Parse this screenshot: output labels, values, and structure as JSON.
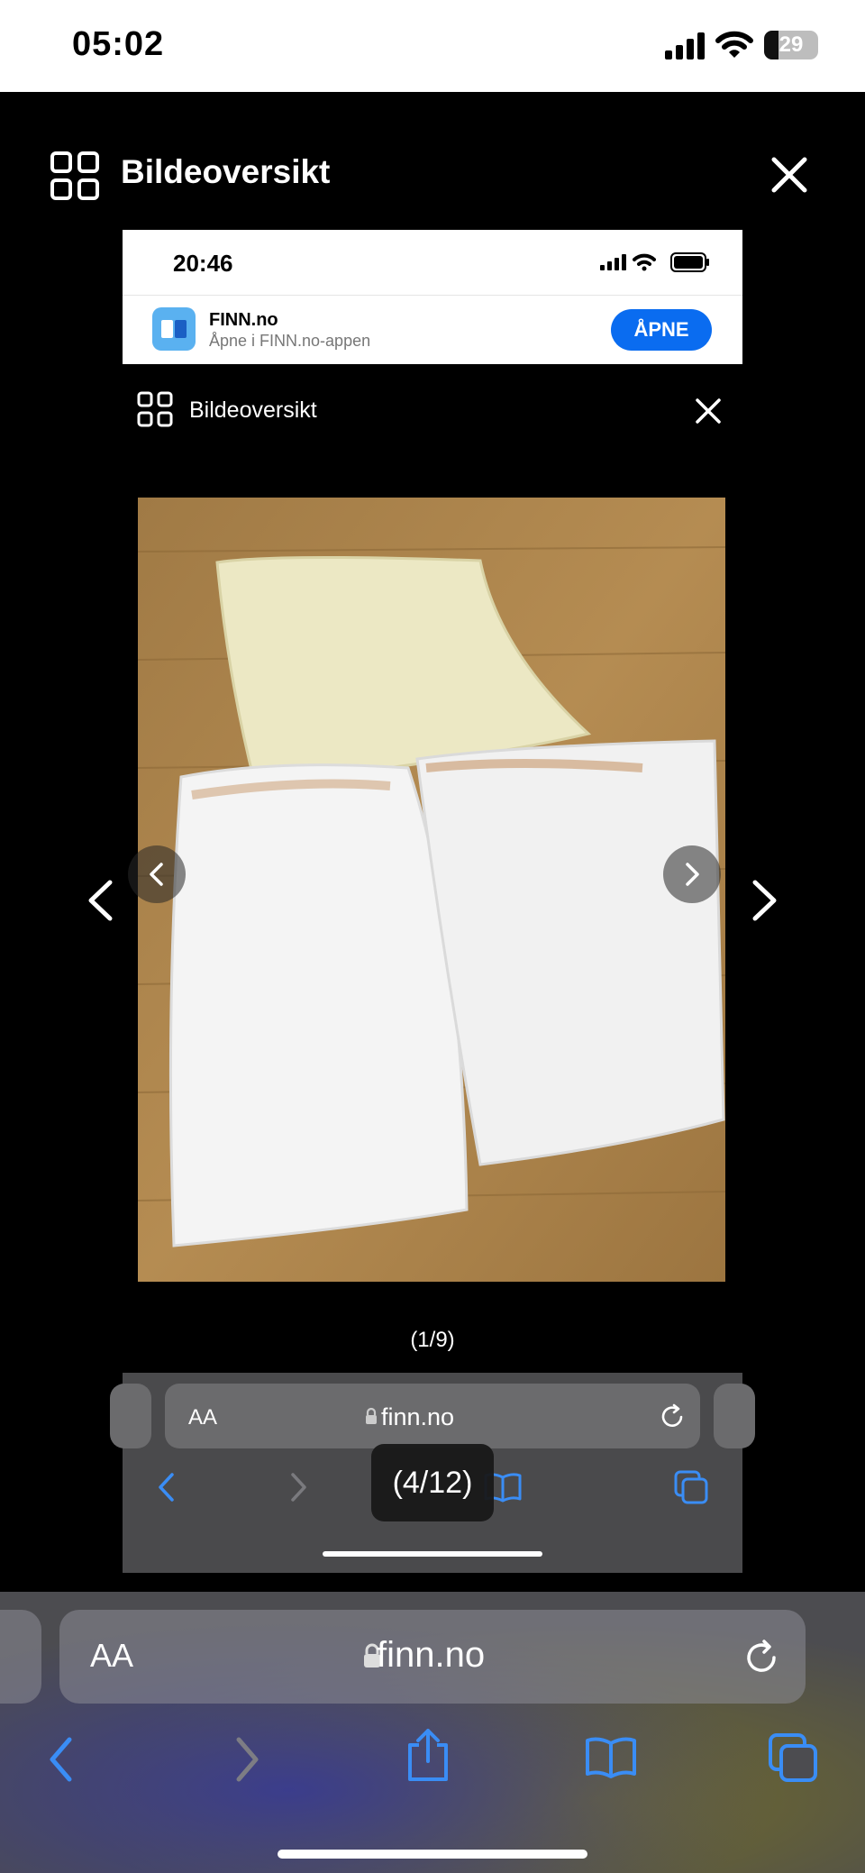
{
  "status_bar": {
    "time": "05:02",
    "battery": "29"
  },
  "lightbox": {
    "title": "Bildeoversikt"
  },
  "inner": {
    "time": "20:46",
    "app_banner": {
      "name": "FINN.no",
      "subtitle": "Åpne i FINN.no-appen",
      "open_label": "ÅPNE"
    },
    "lightbox_title": "Bildeoversikt",
    "counter": "(1/9)",
    "url_bar": {
      "aa": "AA",
      "domain": "finn.no"
    }
  },
  "counter_overlay": "(4/12)",
  "safari": {
    "aa": "AA",
    "domain": "finn.no"
  },
  "colors": {
    "accent_blue": "#0a6cf0",
    "safari_icon_blue": "#3a8df5"
  },
  "icons": [
    "grid-icon",
    "close-icon",
    "chevron-left-icon",
    "chevron-right-icon",
    "lock-icon",
    "reload-icon",
    "share-icon",
    "bookmarks-icon",
    "tabs-icon",
    "wifi-icon",
    "signal-icon"
  ]
}
